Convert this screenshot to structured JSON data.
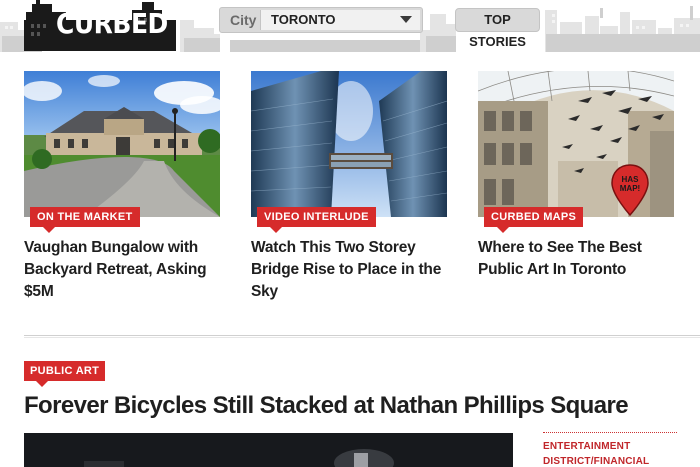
{
  "header": {
    "logo_text": "CURBED",
    "city_label": "City",
    "city_value": "TORONTO",
    "top_stories_label": "TOP STORIES"
  },
  "cards": [
    {
      "tag": "ON THE MARKET",
      "headline": "Vaughan Bungalow with Backyard Retreat, Asking $5M"
    },
    {
      "tag": "VIDEO INTERLUDE",
      "headline": "Watch This Two Storey Bridge Rise to Place in the Sky"
    },
    {
      "tag": "CURBED MAPS",
      "headline": "Where to See The Best Public Art In Toronto",
      "badge": "HAS MAP!"
    }
  ],
  "feature": {
    "tag": "PUBLIC ART",
    "title": "Forever Bicycles Still Stacked at Nathan Phillips Square"
  },
  "sidebar": {
    "link_text": "ENTERTAINMENT DISTRICT/FINANCIAL DISTRICT"
  },
  "colors": {
    "accent_red": "#d62b2b",
    "header_gray": "#d9d9d9",
    "text_dark": "#1f1f1f"
  }
}
